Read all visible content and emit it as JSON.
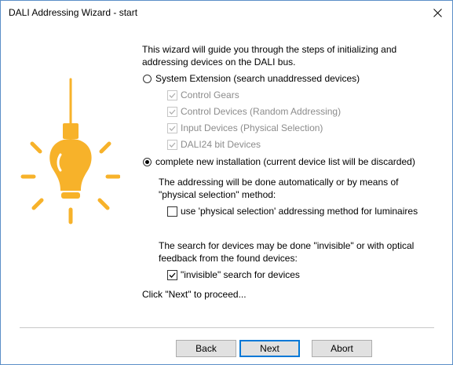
{
  "window": {
    "title": "DALI Addressing Wizard - start",
    "close_glyph": "✕"
  },
  "intro": {
    "line1": "This wizard will guide you through the steps of initializing and",
    "line2": "addressing devices on the DALI bus."
  },
  "options": {
    "system_extension": {
      "label": "System Extension (search unaddressed devices)",
      "selected": false
    },
    "sub_options": [
      {
        "label": "Control Gears",
        "checked": true,
        "enabled": false
      },
      {
        "label": "Control Devices (Random Addressing)",
        "checked": true,
        "enabled": false
      },
      {
        "label": "Input Devices (Physical Selection)",
        "checked": true,
        "enabled": false
      },
      {
        "label": "DALI24 bit Devices",
        "checked": true,
        "enabled": false
      }
    ],
    "complete_install": {
      "label": "complete new installation (current device list will be discarded)",
      "selected": true
    }
  },
  "addressing": {
    "line1": "The addressing will be done automatically or by means of",
    "line2": "\"physical selection\" method:",
    "checkbox_label": "use 'physical selection' addressing method for luminaires",
    "checked": false
  },
  "search": {
    "line1": "The search for devices may be done \"invisible\" or with optical",
    "line2": "feedback from the found devices:",
    "checkbox_label": "\"invisible\" search for devices",
    "checked": true
  },
  "proceed_text": "Click \"Next\" to proceed...",
  "buttons": {
    "back": "Back",
    "next": "Next",
    "abort": "Abort"
  },
  "colors": {
    "bulb": "#f7b22a",
    "bulb_wire": "#f7b22a",
    "window_border": "#5b8fc7",
    "default_button_border": "#0078d7"
  },
  "icons": {
    "bulb": "lightbulb-icon",
    "close": "close-icon"
  }
}
